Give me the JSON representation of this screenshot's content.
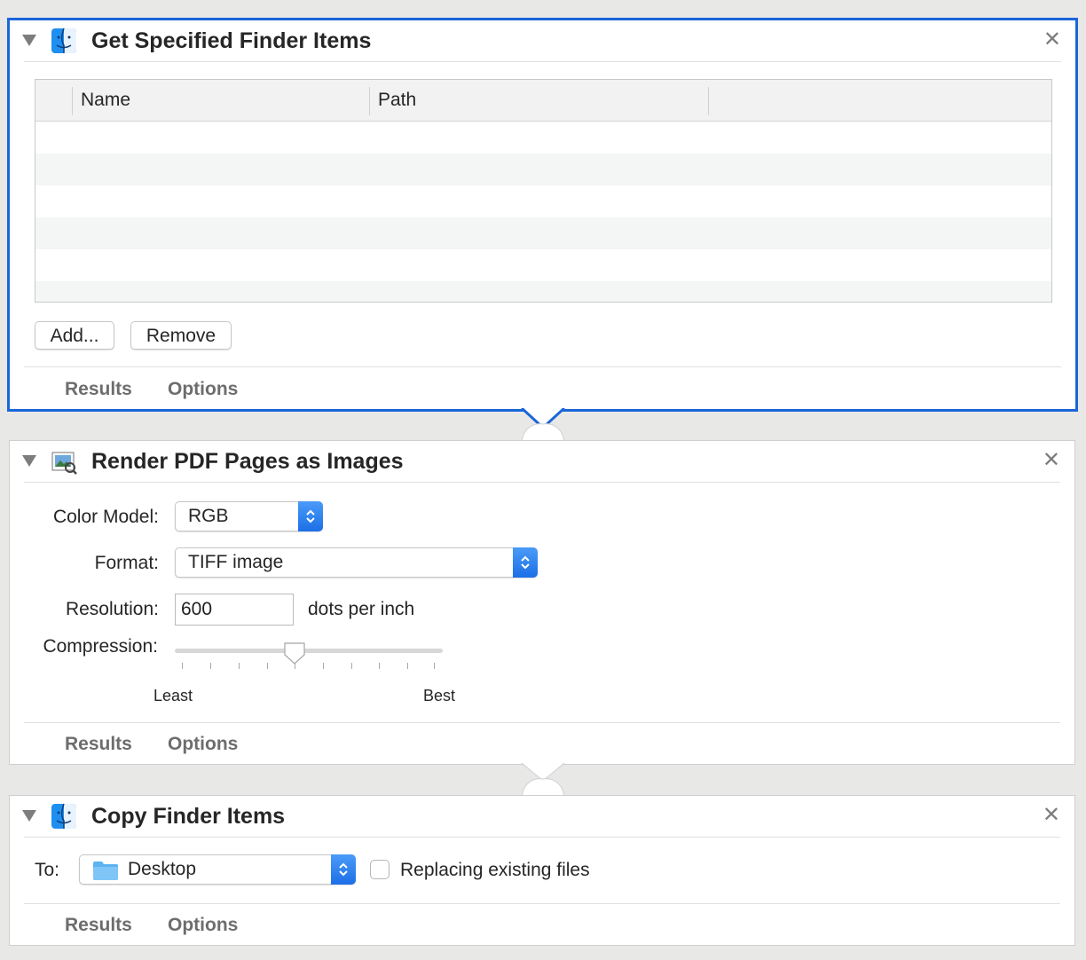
{
  "actions": [
    {
      "title": "Get Specified Finder Items",
      "icon": "finder-icon",
      "table": {
        "columns": [
          "Name",
          "Path"
        ],
        "rows": []
      },
      "buttons": {
        "add": "Add...",
        "remove": "Remove"
      },
      "footer": {
        "results": "Results",
        "options": "Options"
      }
    },
    {
      "title": "Render PDF Pages as Images",
      "icon": "preview-image-icon",
      "fields": {
        "color_model": {
          "label": "Color Model:",
          "value": "RGB"
        },
        "format": {
          "label": "Format:",
          "value": "TIFF image"
        },
        "resolution": {
          "label": "Resolution:",
          "value": "600",
          "unit": "dots per inch"
        },
        "compression": {
          "label": "Compression:",
          "min_label": "Least",
          "max_label": "Best",
          "value_fraction": 0.44
        }
      },
      "footer": {
        "results": "Results",
        "options": "Options"
      }
    },
    {
      "title": "Copy Finder Items",
      "icon": "finder-icon",
      "fields": {
        "to": {
          "label": "To:",
          "value": "Desktop",
          "icon": "folder-icon"
        },
        "replacing": {
          "label": "Replacing existing files",
          "checked": false
        }
      },
      "footer": {
        "results": "Results",
        "options": "Options"
      }
    }
  ],
  "colors": {
    "selection": "#1a66d9",
    "popup_accent": "#2f80f0"
  }
}
